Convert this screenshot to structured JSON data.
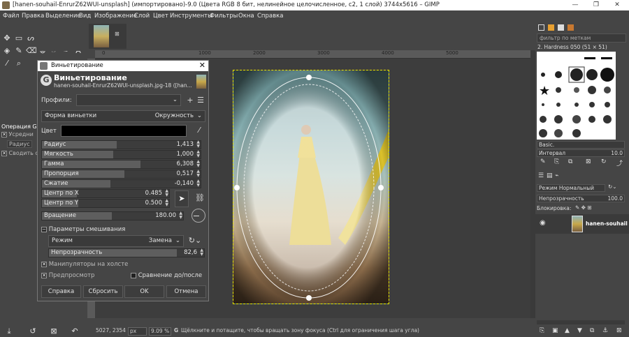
{
  "window": {
    "title": "[hanen-souhail-EnrurZ62WUI-unsplash] (импортировано)-9.0 (Цвета RGB 8 бит, нелинейное целочисленное, с2, 1 слой) 3744x5616 – GIMP",
    "minimize": "—",
    "maximize": "❐",
    "close": "✕"
  },
  "menu": [
    "Файл",
    "Правка",
    "Выделение",
    "Вид",
    "Изображение",
    "Слой",
    "Цвет",
    "Инструменты",
    "Фильтры",
    "Окна",
    "Справка"
  ],
  "tool_options": {
    "title": "Операция GI",
    "option1": "Усредни",
    "option2": "Радиус",
    "option3": "Сводить с"
  },
  "ruler": {
    "marks": [
      "0",
      "1000",
      "2000",
      "3000",
      "4000",
      "5000"
    ]
  },
  "statusbar": {
    "coords": "5027, 2354",
    "unit": "px",
    "zoom": "9.09 %",
    "message": "Щёлкните и потащите, чтобы вращать зону фокуса (Ctrl для ограничения шага угла)"
  },
  "dialog": {
    "window_title": "Виньетирование",
    "heading": "Виньетирование",
    "subtitle": "hanen-souhail-EnrurZ62WUI-unsplash.jpg-18 ([han...",
    "profiles_label": "Профили:",
    "shape_label": "Форма виньетки",
    "shape_value": "Окружность",
    "color_label": "Цвет",
    "color_value": "#000000",
    "params": [
      {
        "label": "Радиус",
        "value": "1,413",
        "fill": 0.47
      },
      {
        "label": "Мягкость",
        "value": "1,000",
        "fill": 0.45
      },
      {
        "label": "Гамма",
        "value": "6,308",
        "fill": 0.62
      },
      {
        "label": "Пропорция",
        "value": "0,517",
        "fill": 0.52
      },
      {
        "label": "Сжатие",
        "value": "-0,140",
        "fill": 0.43
      }
    ],
    "center_x_label": "Центр по X",
    "center_x_value": "0.485",
    "center_y_label": "Центр по Y",
    "center_y_value": "0.500",
    "rotation_label": "Вращение",
    "rotation_value": "180.00",
    "blend_section": "Параметры смешивания",
    "mode_label": "Режим",
    "mode_value": "Замена",
    "opacity_label": "Непрозрачность",
    "opacity_value": "82,6",
    "opacity_fraction": 0.826,
    "on_canvas": "Манипуляторы на холсте",
    "preview": "Предпросмотр",
    "split_view": "Сравнение до/после",
    "btn_help": "Справка",
    "btn_reset": "Сбросить",
    "btn_ok": "OK",
    "btn_cancel": "Отмена"
  },
  "right_panel": {
    "filter_placeholder": "фильтр по меткам",
    "brush_name": "2. Hardness 050 (51 × 51)",
    "preset": "Basic.",
    "interval_label": "Интервал",
    "interval_value": "10.0",
    "mode_label": "Режим",
    "mode_value": "Нормальный",
    "opacity_label": "Непрозрачность",
    "opacity_value": "100.0",
    "lock_label": "Блокировка:",
    "layer_name": "hanen-souhail"
  },
  "colors": {
    "accent": "#e8e800",
    "bg": "#454545"
  }
}
